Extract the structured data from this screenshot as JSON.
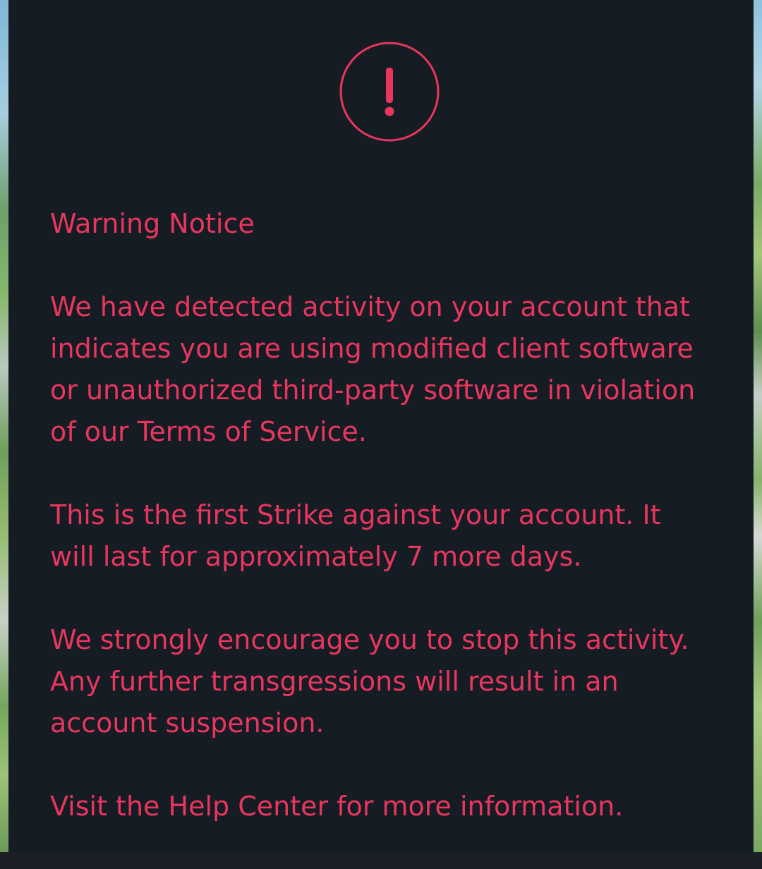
{
  "dialog": {
    "icon": "exclamation-circle-icon",
    "title": "Warning Notice",
    "paragraph1": {
      "text_before": "We have detected activity on your account that indicates you are using modified client software or unauthorized third-party software in violation of our",
      "link_label": "Terms of Service",
      "text_after": "."
    },
    "paragraph2": "This is the first Strike against your account. It will last for approximately 7 more days.",
    "paragraph3": "We strongly encourage you to stop this activity. Any further transgressions will result in an account suspension.",
    "paragraph4": {
      "link_label": "Visit the Help Center",
      "text_after": "for more information."
    }
  },
  "colors": {
    "background": "#161c24",
    "accent": "#e8365e"
  }
}
